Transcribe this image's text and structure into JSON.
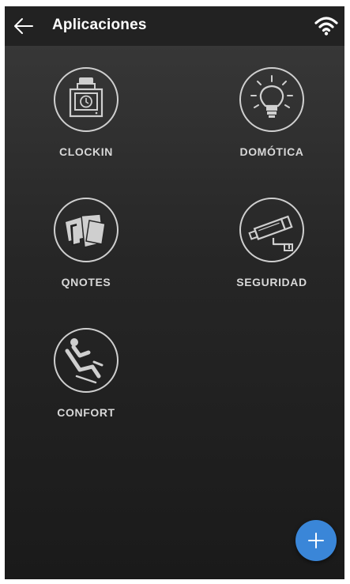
{
  "header": {
    "title": "Aplicaciones",
    "back_icon": "arrow-left-icon",
    "status_icon": "wifi-icon"
  },
  "apps": [
    {
      "label": "CLOCKIN",
      "icon": "time-clock-icon"
    },
    {
      "label": "DOMÓTICA",
      "icon": "light-bulb-icon"
    },
    {
      "label": "QNOTES",
      "icon": "notes-icon"
    },
    {
      "label": "SEGURIDAD",
      "icon": "security-camera-icon"
    },
    {
      "label": "CONFORT",
      "icon": "reclining-seat-icon"
    }
  ],
  "fab": {
    "icon": "plus-icon"
  },
  "colors": {
    "appbar": "#222222",
    "icon_stroke": "#d0d0d0",
    "fab": "#3a86d8"
  }
}
